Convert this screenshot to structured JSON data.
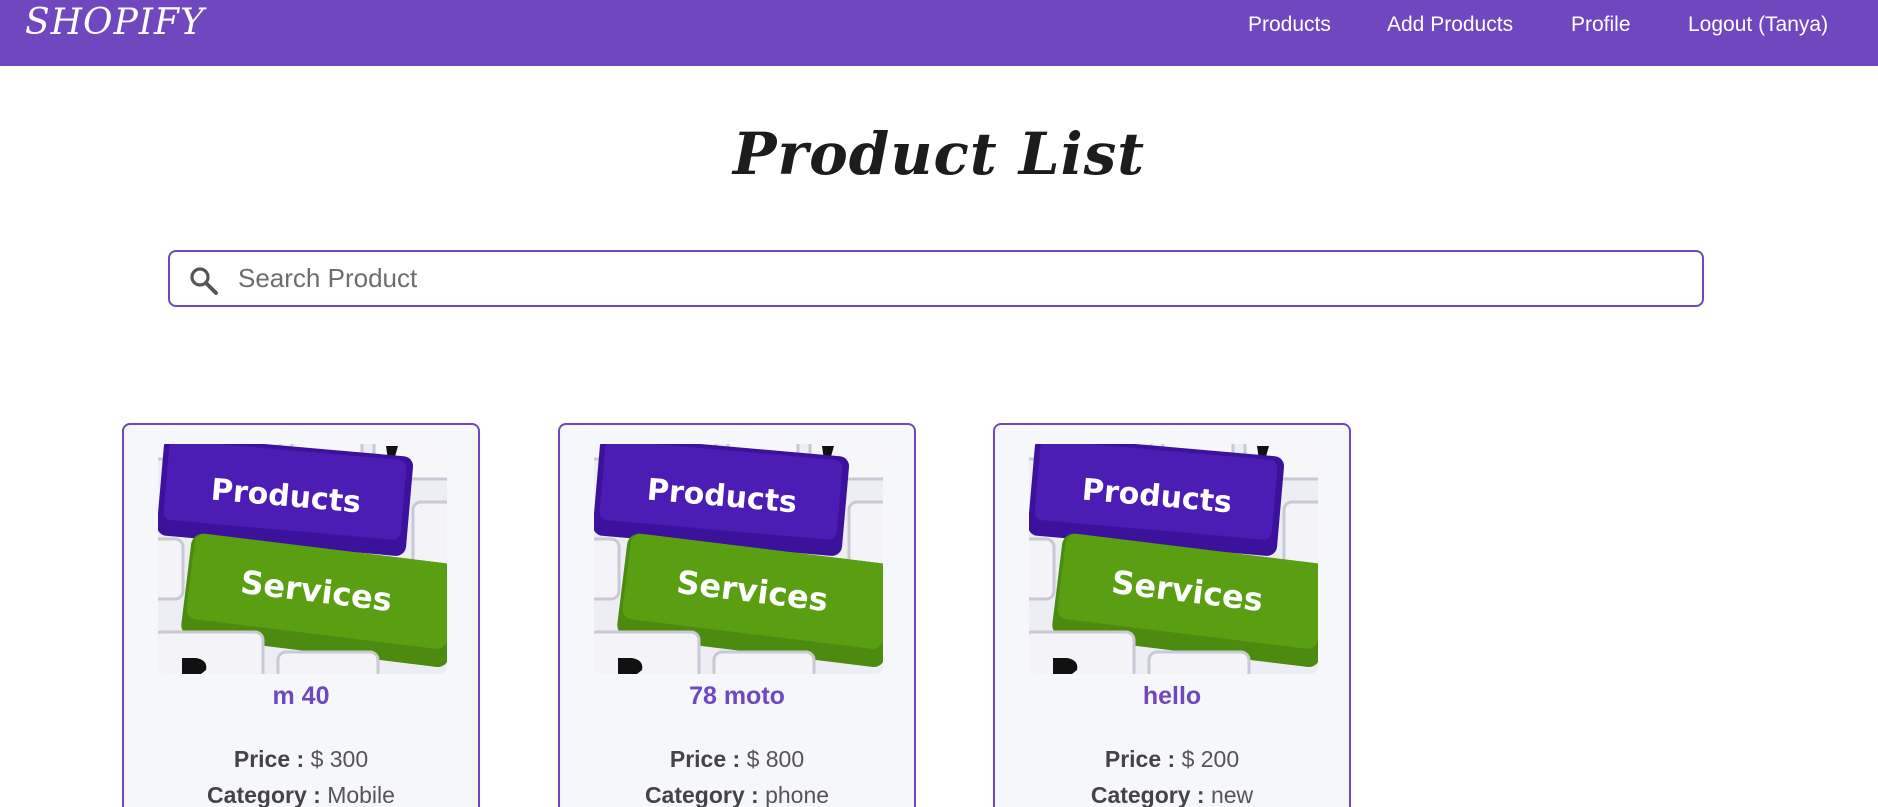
{
  "navbar": {
    "brand": "SHOPIFY",
    "links": [
      {
        "label": "Products"
      },
      {
        "label": "Add Products"
      },
      {
        "label": "Profile"
      },
      {
        "label": "Logout (Tanya)"
      }
    ],
    "bg_color": "#6f47be"
  },
  "page": {
    "title": "Product List"
  },
  "search": {
    "placeholder": "Search Product",
    "icon": "search-icon"
  },
  "products": [
    {
      "name": "m 40",
      "price_label": "Price :",
      "price": "$ 300",
      "category_label": "Category :",
      "category": "Mobile",
      "image": "products-services-keyboard-image"
    },
    {
      "name": "78 moto",
      "price_label": "Price :",
      "price": "$ 800",
      "category_label": "Category :",
      "category": "phone",
      "image": "products-services-keyboard-image"
    },
    {
      "name": "hello",
      "price_label": "Price :",
      "price": "$ 200",
      "category_label": "Category :",
      "category": "new",
      "image": "products-services-keyboard-image"
    }
  ],
  "image_text": {
    "top_key": "Products",
    "bottom_key": "Services"
  },
  "colors": {
    "accent": "#6f47be",
    "card_bg": "#f6f7fa"
  }
}
